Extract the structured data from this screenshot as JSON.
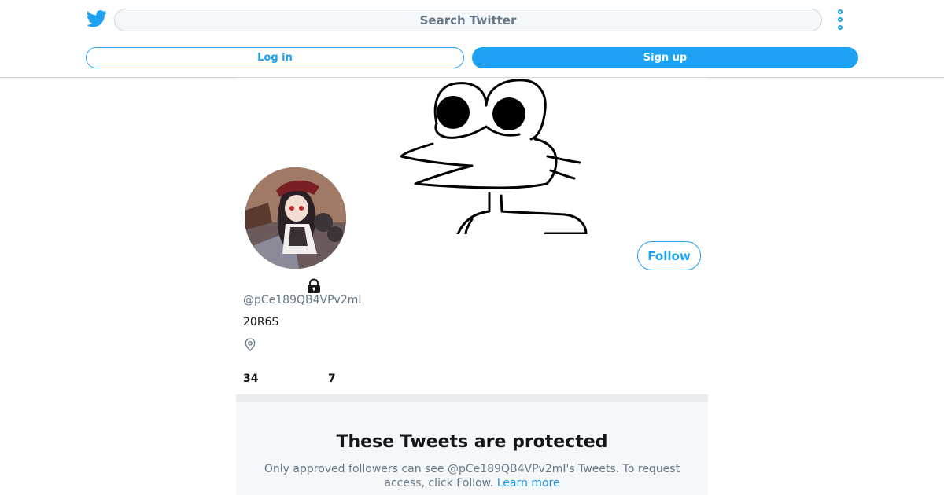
{
  "header": {
    "logo_icon": "twitter-bird-icon",
    "search_placeholder": "Search Twitter",
    "more_icon": "more-vertical-icon",
    "login_label": "Log in",
    "signup_label": "Sign up"
  },
  "profile": {
    "banner_image": "cartoon-frog-drawing",
    "avatar_image": "anime-girl-avatar",
    "follow_label": "Follow",
    "lock_icon": "lock-icon",
    "handle": "@pCe189QB4VPv2mI",
    "bio": "20R6S",
    "location_icon": "location-pin-icon",
    "following_count": "34",
    "followers_count": "7"
  },
  "protected": {
    "title": "These Tweets are protected",
    "message": "Only approved followers can see @pCe189QB4VPv2mI's Tweets. To request access, click Follow.",
    "learn_more": "Learn more"
  },
  "colors": {
    "accent": "#1da1f2",
    "secondary_text": "#657786",
    "panel_bg": "#f5f8fa"
  }
}
